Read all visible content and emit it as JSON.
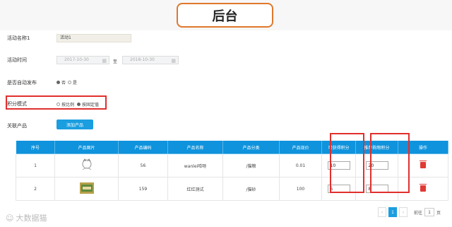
{
  "header": {
    "title": "后台"
  },
  "form": {
    "activity_name_label": "活动名称1",
    "activity_name_value": "活动1",
    "activity_time_label": "活动时间",
    "start_date": "2017-10-30",
    "date_sep": "至",
    "end_date": "2018-10-30",
    "auto_publish_label": "是否自动发布",
    "auto_publish_options": [
      "否",
      "是"
    ],
    "points_mode_label": "积分模式",
    "points_mode_options": [
      "按比例",
      "按固定值"
    ],
    "related_products_label": "关联产品",
    "add_product_button": "添加产品"
  },
  "table": {
    "headers": [
      "序号",
      "产品图片",
      "产品编码",
      "产品名称",
      "产品分类",
      "产品现价",
      "可获得积分",
      "推荐购物积分",
      "操作"
    ],
    "rows": [
      {
        "index": "1",
        "code": "56",
        "name": "wanlei哈呀",
        "category": "/猫粮",
        "price": "0.01",
        "points": "10",
        "recommend_points": "20"
      },
      {
        "index": "2",
        "code": "159",
        "name": "红红测试",
        "category": "/猫砂",
        "price": "100",
        "points": "5",
        "recommend_points": "8"
      }
    ]
  },
  "pager": {
    "current": "1",
    "goto_label": "前往",
    "page_input": "1",
    "page_unit": "页",
    "prev": "‹",
    "next": "›"
  },
  "watermark": "大数据猫",
  "colors": {
    "accent": "#0f93dc",
    "highlight": "#e0302e",
    "title_border": "#e0782c"
  }
}
